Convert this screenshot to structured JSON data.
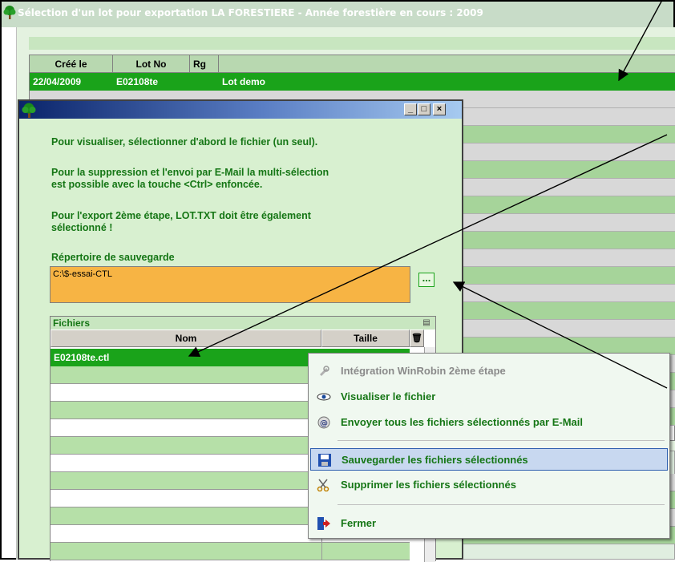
{
  "window": {
    "title": "Sélection d'un lot pour exportation LA FORESTIERE  -  Année forestière en cours : 2009"
  },
  "grid": {
    "headers": [
      "Créé le",
      "Lot No",
      "Rg",
      ""
    ],
    "selected_row": {
      "created": "22/04/2009",
      "lot": "E02108te",
      "name": "Lot demo"
    }
  },
  "dialog": {
    "buttons": {
      "minimize": "_",
      "maximize": "□",
      "close": "×"
    },
    "message1": "Pour visualiser, sélectionner d'abord le fichier (un seul).",
    "message2": "Pour la suppression et l'envoi par E-Mail la multi-sélection\nest possible avec la touche <Ctrl> enfoncée.",
    "message3": "Pour l'export 2ème étape, LOT.TXT doit être également\nsélectionné !",
    "dir_label": "Répertoire de sauvegarde",
    "dir_value": "C:\\$-essai-CTL",
    "browse_label": "...",
    "files": {
      "caption": "Fichiers",
      "col_name": "Nom",
      "col_size": "Taille",
      "selected_file": "E02108te.ctl"
    }
  },
  "context_menu": {
    "items": [
      {
        "label": "Intégration WinRobin 2ème étape",
        "icon": "gear-icon",
        "disabled": true
      },
      {
        "label": "Visualiser le fichier",
        "icon": "eye-icon"
      },
      {
        "label": "Envoyer tous les fichiers sélectionnés par E-Mail",
        "icon": "email-icon"
      },
      {
        "label": "Sauvegarder les fichiers sélectionnés",
        "icon": "save-icon",
        "highlighted": true
      },
      {
        "label": "Supprimer les  fichiers sélectionnés",
        "icon": "scissors-icon"
      },
      {
        "label": "Fermer",
        "icon": "exit-icon"
      }
    ]
  },
  "colors": {
    "selection_green": "#1aa31a",
    "text_green": "#157615",
    "dir_field_orange": "#f7b444",
    "row_green": "#a6d49a",
    "menu_highlight": "#c8d8f0"
  }
}
